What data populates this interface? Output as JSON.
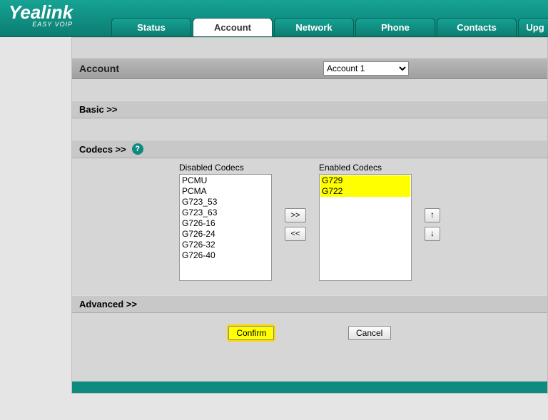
{
  "logo": {
    "brand": "Yealink",
    "sub": "EASY VOIP"
  },
  "tabs": {
    "items": [
      {
        "label": "Status"
      },
      {
        "label": "Account"
      },
      {
        "label": "Network"
      },
      {
        "label": "Phone"
      },
      {
        "label": "Contacts"
      },
      {
        "label": "Upg"
      }
    ],
    "activeIndex": 1
  },
  "account": {
    "header": "Account",
    "selected": "Account 1",
    "options": [
      "Account 1"
    ]
  },
  "sections": {
    "basic": "Basic >>",
    "codecs": "Codecs >>",
    "advanced": "Advanced >>"
  },
  "codecs": {
    "disabledLabel": "Disabled Codecs",
    "enabledLabel": "Enabled Codecs",
    "disabled": [
      "PCMU",
      "PCMA",
      "G723_53",
      "G723_63",
      "G726-16",
      "G726-24",
      "G726-32",
      "G726-40"
    ],
    "enabled": [
      "G729",
      "G722"
    ],
    "enabledHighlight": [
      0,
      1
    ],
    "moveRight": ">>",
    "moveLeft": "<<",
    "moveUp": "↑",
    "moveDown": "↓"
  },
  "buttons": {
    "confirm": "Confirm",
    "cancel": "Cancel"
  },
  "helpIcon": "?"
}
